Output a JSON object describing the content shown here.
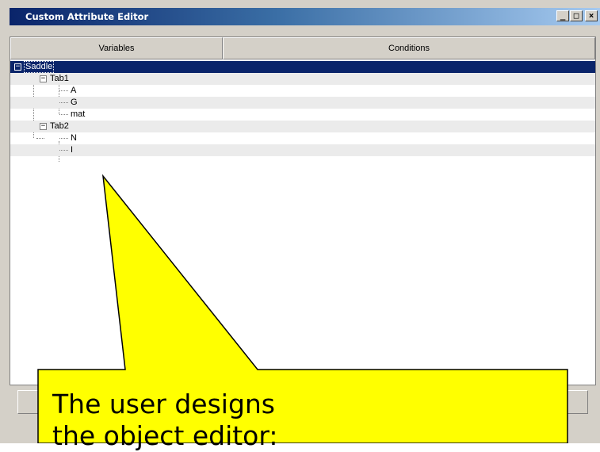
{
  "window": {
    "title": "Custom Attribute Editor",
    "buttons": {
      "minimize": "_",
      "maximize": "□",
      "close": "×"
    }
  },
  "columns": {
    "variables": "Variables",
    "conditions": "Conditions"
  },
  "tree": {
    "root": "Saddle",
    "tab1": {
      "label": "Tab1",
      "items": [
        "A",
        "G",
        "mat"
      ]
    },
    "tab2": {
      "label": "Tab2",
      "items": [
        "N",
        "I"
      ]
    }
  },
  "callout": {
    "text": "The user designs\nthe object editor:",
    "fill_color": "#ffff00"
  },
  "colors": {
    "title_bar": "#0a246a",
    "selected_row": "#0a246a",
    "alt_row": "#ebebeb",
    "chrome": "#d4d0c8"
  }
}
